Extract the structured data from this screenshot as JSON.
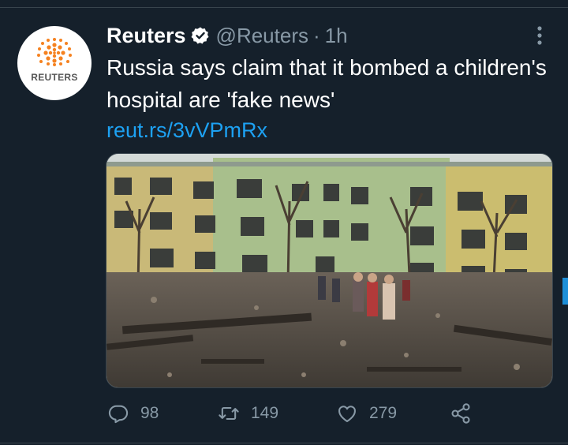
{
  "tweet": {
    "author_name": "Reuters",
    "author_handle": "@Reuters",
    "separator": "·",
    "time": "1h",
    "avatar_label": "REUTERS",
    "text": "Russia says claim that it bombed a children's hospital are 'fake news'",
    "link": "reut.rs/3vVPmRx"
  },
  "actions": {
    "reply_count": "98",
    "retweet_count": "149",
    "like_count": "279"
  },
  "colors": {
    "background": "#15202b",
    "secondary_text": "#8899a6",
    "link": "#1da1f2",
    "brand_orange": "#f58220"
  },
  "icons": [
    "reuters-logo",
    "verified-badge-icon",
    "more-options-icon",
    "reply-icon",
    "retweet-icon",
    "like-icon",
    "share-icon"
  ]
}
